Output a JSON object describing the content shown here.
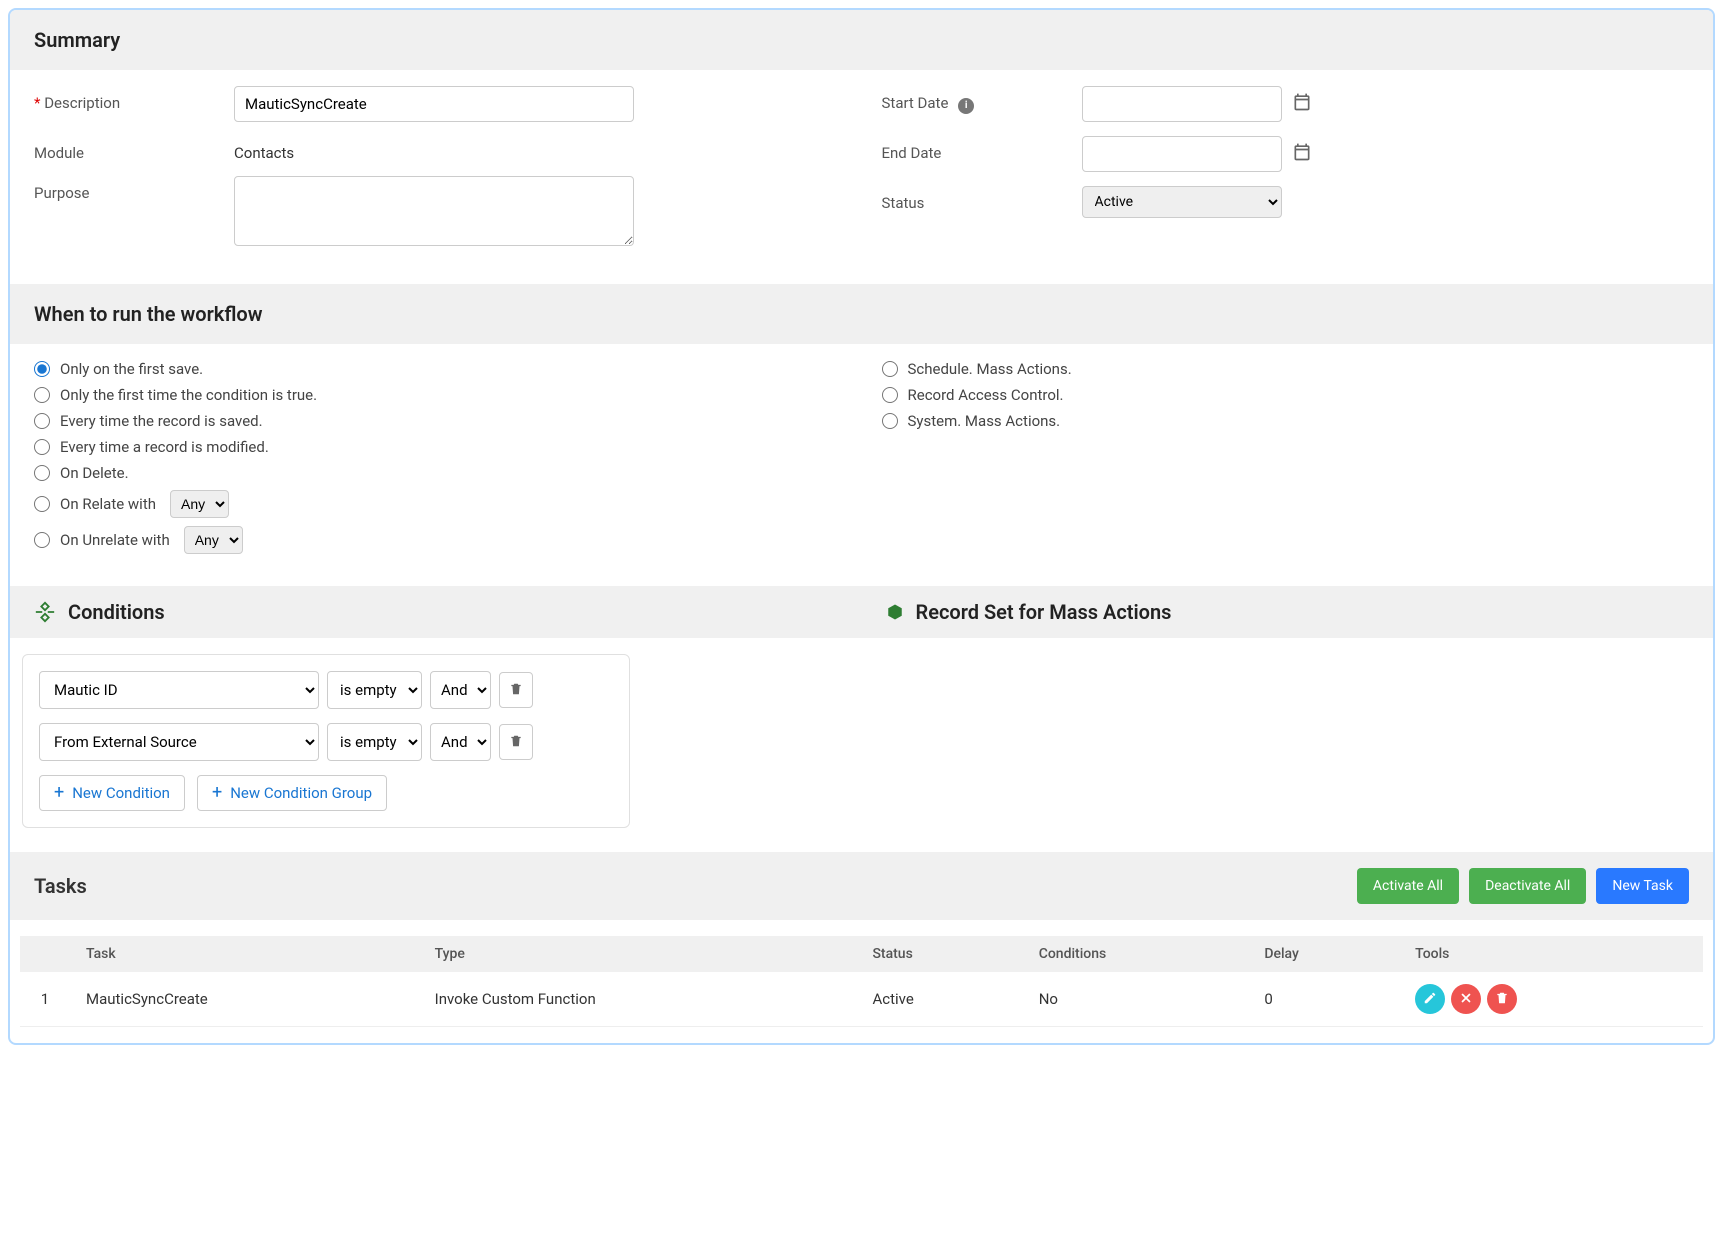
{
  "summary": {
    "title": "Summary",
    "description_label": "Description",
    "description_value": "MauticSyncCreate",
    "module_label": "Module",
    "module_value": "Contacts",
    "purpose_label": "Purpose",
    "purpose_value": "",
    "start_date_label": "Start Date",
    "start_date_value": "",
    "end_date_label": "End Date",
    "end_date_value": "",
    "status_label": "Status",
    "status_value": "Active"
  },
  "trigger": {
    "title": "When to run the workflow",
    "options_left": [
      "Only on the first save.",
      "Only the first time the condition is true.",
      "Every time the record is saved.",
      "Every time a record is modified.",
      "On Delete."
    ],
    "on_relate_label": "On Relate with",
    "on_relate_value": "Any",
    "on_unrelate_label": "On Unrelate with",
    "on_unrelate_value": "Any",
    "options_right": [
      "Schedule. Mass Actions.",
      "Record Access Control.",
      "System. Mass Actions."
    ],
    "selected_index": 0
  },
  "conditions": {
    "title": "Conditions",
    "recordset_title": "Record Set for Mass Actions",
    "rows": [
      {
        "field": "Mautic ID",
        "op": "is empty",
        "logic": "And"
      },
      {
        "field": "From External Source",
        "op": "is empty",
        "logic": "And"
      }
    ],
    "new_condition_label": "New Condition",
    "new_group_label": "New Condition Group"
  },
  "tasks": {
    "title": "Tasks",
    "activate_all_label": "Activate All",
    "deactivate_all_label": "Deactivate All",
    "new_task_label": "New Task",
    "columns": {
      "num": "",
      "task": "Task",
      "type": "Type",
      "status": "Status",
      "conditions": "Conditions",
      "delay": "Delay",
      "tools": "Tools"
    },
    "rows": [
      {
        "num": "1",
        "task": "MauticSyncCreate",
        "type": "Invoke Custom Function",
        "status": "Active",
        "conditions": "No",
        "delay": "0"
      }
    ]
  }
}
